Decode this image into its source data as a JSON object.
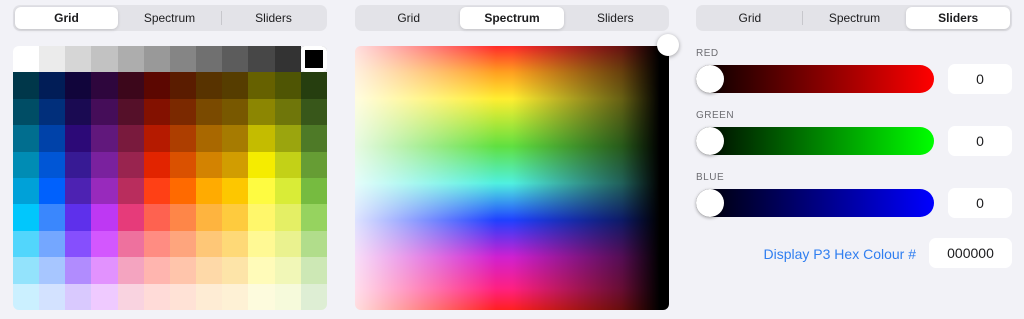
{
  "panels": [
    {
      "tabs": [
        "Grid",
        "Spectrum",
        "Sliders"
      ],
      "active": 0
    },
    {
      "tabs": [
        "Grid",
        "Spectrum",
        "Sliders"
      ],
      "active": 1
    },
    {
      "tabs": [
        "Grid",
        "Spectrum",
        "Sliders"
      ],
      "active": 2
    }
  ],
  "grid": {
    "columns": 12,
    "selected_color": "#000000",
    "rows": [
      [
        "#ffffff",
        "#ebebeb",
        "#d6d6d6",
        "#c2c2c2",
        "#adadad",
        "#999999",
        "#858585",
        "#707070",
        "#5c5c5c",
        "#474747",
        "#333333",
        "#000000"
      ],
      [
        "#00374a",
        "#011d57",
        "#11053b",
        "#2e063d",
        "#3c071b",
        "#5c0701",
        "#5a1c00",
        "#583300",
        "#563d00",
        "#666100",
        "#4f5504",
        "#263e0f"
      ],
      [
        "#004d65",
        "#012f7b",
        "#1a0a52",
        "#450d59",
        "#551029",
        "#831100",
        "#7b2900",
        "#7a4a00",
        "#785800",
        "#8c8602",
        "#6f760a",
        "#38571a"
      ],
      [
        "#016e8f",
        "#0042a9",
        "#2c0977",
        "#61187c",
        "#791a3d",
        "#b51a00",
        "#ad3e00",
        "#a96800",
        "#a67b01",
        "#c4bc00",
        "#9ba50e",
        "#4e7a27"
      ],
      [
        "#008cb4",
        "#0056d6",
        "#371a94",
        "#7a219e",
        "#99244f",
        "#e22400",
        "#da5100",
        "#d38301",
        "#d19d01",
        "#f5ec00",
        "#c3d117",
        "#669d34"
      ],
      [
        "#00a1d8",
        "#0061fd",
        "#4d22b2",
        "#982abc",
        "#b92d5d",
        "#ff4015",
        "#ff6a00",
        "#ffab01",
        "#fdc700",
        "#fefb41",
        "#d9ec37",
        "#76bb40"
      ],
      [
        "#01c7fc",
        "#3a87fd",
        "#5e30eb",
        "#be38f3",
        "#e63b7a",
        "#fe6250",
        "#fe8648",
        "#feb43f",
        "#fecb3e",
        "#fff76b",
        "#e4ef65",
        "#96d35f"
      ],
      [
        "#52d6fc",
        "#74a7ff",
        "#864ffd",
        "#d357fe",
        "#ee719e",
        "#ff8c82",
        "#fea57d",
        "#fec777",
        "#fed977",
        "#fff994",
        "#eaf28f",
        "#b1dd8b"
      ],
      [
        "#93e3fc",
        "#a7c6ff",
        "#b18cfe",
        "#e292fe",
        "#f4a4c0",
        "#ffb5af",
        "#ffc5ab",
        "#fed9a8",
        "#fde4a8",
        "#fffbb9",
        "#f1f7b7",
        "#cde8b5"
      ],
      [
        "#cbf0ff",
        "#d3e2ff",
        "#d9c9fe",
        "#efcaff",
        "#f9d3e0",
        "#ffdbd8",
        "#ffe2d6",
        "#feecd4",
        "#fef1d5",
        "#fdfbdd",
        "#f6fadb",
        "#deeed4"
      ]
    ]
  },
  "sliders": [
    {
      "label": "RED",
      "value": "0",
      "color": "#ff0000"
    },
    {
      "label": "GREEN",
      "value": "0",
      "color": "#00ff00"
    },
    {
      "label": "BLUE",
      "value": "0",
      "color": "#0000ff"
    }
  ],
  "hex": {
    "label": "Display P3 Hex Colour #",
    "value": "000000"
  }
}
